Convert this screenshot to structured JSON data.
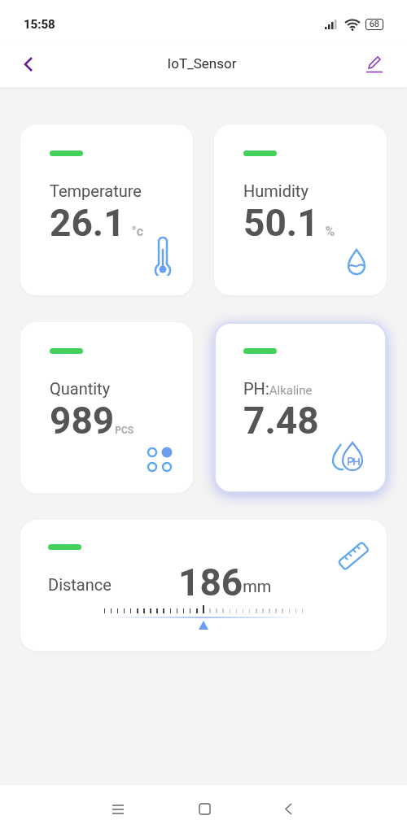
{
  "status_bar": {
    "time": "15:58",
    "battery": "68"
  },
  "header": {
    "title": "IoT_Sensor"
  },
  "cards": [
    {
      "kind": "temperature",
      "label": "Temperature",
      "value": "26.1",
      "unit": "°c",
      "selected": false
    },
    {
      "kind": "humidity",
      "label": "Humidity",
      "value": "50.1",
      "unit": "%",
      "selected": false
    },
    {
      "kind": "quantity",
      "label": "Quantity",
      "value": "989",
      "unit": "PCS",
      "selected": false
    },
    {
      "kind": "ph",
      "label": "PH:",
      "sublabel": "Alkaline",
      "value": "7.48",
      "selected": true
    }
  ],
  "distance": {
    "label": "Distance",
    "value": "186",
    "unit": "mm",
    "level": 0.5
  }
}
